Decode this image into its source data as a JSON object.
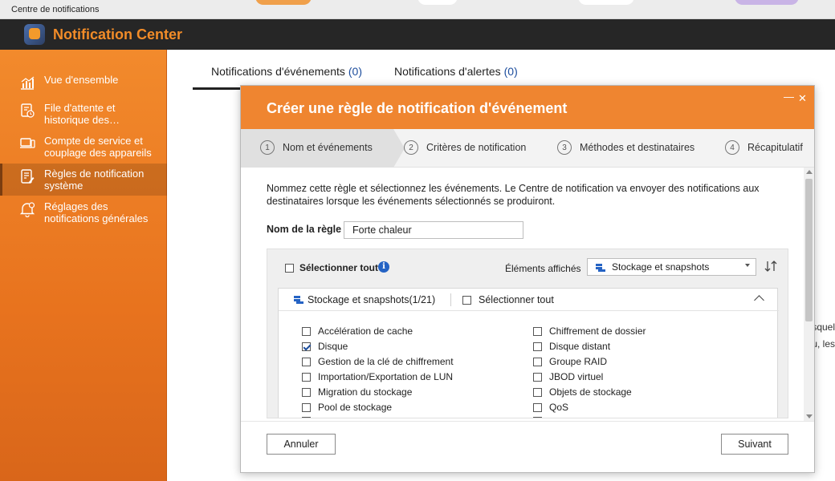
{
  "os_window": {
    "title": "Centre de notifications"
  },
  "app": {
    "title": "Notification Center"
  },
  "sidebar": {
    "items": [
      {
        "label": "Vue d'ensemble",
        "icon": "chart-icon"
      },
      {
        "label": "File d'attente et historique des…",
        "icon": "queue-history-icon"
      },
      {
        "label": "Compte de service et couplage des appareils",
        "icon": "devices-icon"
      },
      {
        "label": "Règles de notification système",
        "icon": "rules-icon",
        "active": true
      },
      {
        "label": "Réglages des notifications générales",
        "icon": "bell-settings-icon"
      }
    ]
  },
  "tabs": [
    {
      "label": "Notifications d'événements",
      "count": "(0)",
      "active": true
    },
    {
      "label": "Notifications d'alertes",
      "count": "(0)"
    }
  ],
  "background_fragments": [
    "squel",
    "u, les"
  ],
  "dialog": {
    "title": "Créer une règle de notification d'événement",
    "controls": {
      "minimize": "—",
      "close": "✕"
    },
    "steps": [
      {
        "num": "1",
        "label": "Nom et événements",
        "active": true
      },
      {
        "num": "2",
        "label": "Critères de notification"
      },
      {
        "num": "3",
        "label": "Méthodes et destinataires"
      },
      {
        "num": "4",
        "label": "Récapitulatif"
      }
    ],
    "description": "Nommez cette règle et sélectionnez les événements. Le Centre de notification va envoyer des notifications aux destinataires lorsque les événements sélectionnés se produiront.",
    "rule_name": {
      "label": "Nom de la règle",
      "value": "Forte chaleur"
    },
    "events": {
      "select_all_label": "Sélectionner tout",
      "displayed_label": "Éléments affichés",
      "displayed_value": "Stockage et snapshots",
      "group": {
        "title": "Stockage et snapshots(1/21)",
        "select_all_label": "Sélectionner tout",
        "left_items": [
          {
            "label": "Accélération de cache",
            "checked": false
          },
          {
            "label": "Disque",
            "checked": true
          },
          {
            "label": "Gestion de la clé de chiffrement",
            "checked": false
          },
          {
            "label": "Importation/Exportation de LUN",
            "checked": false
          },
          {
            "label": "Migration du stockage",
            "checked": false
          },
          {
            "label": "Pool de stockage",
            "checked": false
          }
        ],
        "right_items": [
          {
            "label": "Chiffrement de dossier",
            "checked": false
          },
          {
            "label": "Disque distant",
            "checked": false
          },
          {
            "label": "Groupe RAID",
            "checked": false
          },
          {
            "label": "JBOD virtuel",
            "checked": false
          },
          {
            "label": "Objets de stockage",
            "checked": false
          },
          {
            "label": "QoS",
            "checked": false
          }
        ]
      }
    },
    "buttons": {
      "cancel": "Annuler",
      "next": "Suivant"
    }
  },
  "colors": {
    "accent_orange": "#ef8530",
    "header_dark": "#262626",
    "count_blue": "#1b4c9c",
    "info_blue": "#2563c4"
  }
}
